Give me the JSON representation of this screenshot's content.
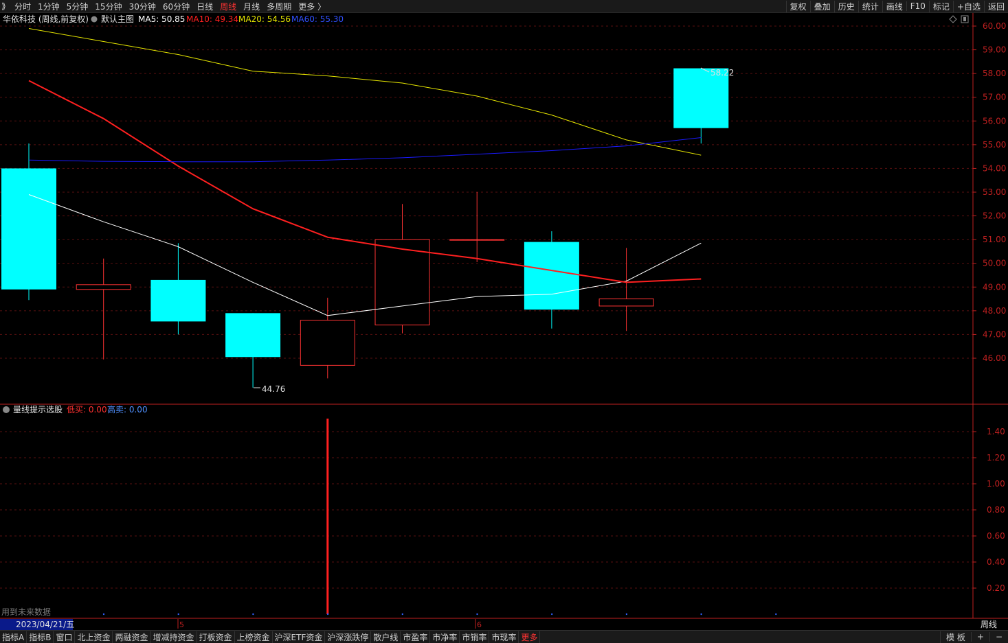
{
  "topbar": {
    "collapse_glyph": "⟫",
    "periods": [
      "分时",
      "1分钟",
      "5分钟",
      "15分钟",
      "30分钟",
      "60分钟",
      "日线",
      "周线",
      "月线",
      "多周期",
      "更多 〉"
    ],
    "active_period": "周线",
    "actions": [
      "复权",
      "叠加",
      "历史",
      "统计",
      "画线",
      "F10",
      "标记",
      "+自选",
      "返回"
    ]
  },
  "main_panel": {
    "stock_title": "华依科技 (周线,前复权)",
    "template_label": "默认主图",
    "ma5": "MA5: 50.85",
    "ma10": "MA10: 49.34",
    "ma20": "MA20: 54.56",
    "ma60": "MA60: 55.30",
    "high_annotation": "58.22",
    "low_annotation": "44.76"
  },
  "sub_panel": {
    "indicator_name": "量线提示选股",
    "low_buy": "低买: 0.00",
    "high_sell": "高卖: 0.00",
    "future_data_note": "用到未来数据"
  },
  "date_axis": {
    "cursor_date": "2023/04/21/五",
    "month_marks": [
      "5",
      "6"
    ],
    "period_label": "周线"
  },
  "colors": {
    "up": "#ff3333",
    "down": "#00ffff",
    "ma5": "#ffffff",
    "ma10": "#ff2020",
    "ma20": "#e6e600",
    "ma60": "#1a1aff",
    "axis": "#c02020",
    "grid": "#5a1010",
    "signal": "#ff2020"
  },
  "chart_data": [
    {
      "type": "candlestick",
      "title": "华依科技 (周线,前复权)",
      "ylim": [
        45.0,
        60.4
      ],
      "y_ticks": [
        46.0,
        47.0,
        48.0,
        49.0,
        50.0,
        51.0,
        52.0,
        53.0,
        54.0,
        55.0,
        56.0,
        57.0,
        58.0,
        59.0,
        60.0
      ],
      "candles": [
        {
          "open": 54.0,
          "close": 48.9,
          "high": 55.05,
          "low": 48.45
        },
        {
          "open": 48.9,
          "close": 49.1,
          "high": 50.2,
          "low": 45.95
        },
        {
          "open": 49.3,
          "close": 47.55,
          "high": 50.85,
          "low": 47.0
        },
        {
          "open": 47.9,
          "close": 46.05,
          "high": 47.9,
          "low": 44.76
        },
        {
          "open": 45.7,
          "close": 47.6,
          "high": 48.55,
          "low": 45.15
        },
        {
          "open": 47.4,
          "close": 51.0,
          "high": 52.5,
          "low": 47.05
        },
        {
          "open": 51.0,
          "close": 51.0,
          "high": 53.0,
          "low": 50.05
        },
        {
          "open": 50.9,
          "close": 48.05,
          "high": 51.35,
          "low": 47.25
        },
        {
          "open": 48.2,
          "close": 48.5,
          "high": 50.65,
          "low": 47.15
        },
        {
          "open": 58.22,
          "close": 55.7,
          "high": 58.22,
          "low": 55.05
        }
      ],
      "series": [
        {
          "name": "MA5",
          "values": [
            52.9,
            51.75,
            50.7,
            49.2,
            47.8,
            48.2,
            48.6,
            48.7,
            49.25,
            50.85
          ]
        },
        {
          "name": "MA10",
          "values": [
            57.7,
            56.1,
            54.1,
            52.3,
            51.1,
            50.6,
            50.2,
            49.7,
            49.2,
            49.34
          ]
        },
        {
          "name": "MA20",
          "values": [
            59.9,
            59.35,
            58.8,
            58.1,
            57.9,
            57.6,
            57.05,
            56.25,
            55.2,
            54.56
          ]
        },
        {
          "name": "MA60",
          "values": [
            54.35,
            54.3,
            54.28,
            54.28,
            54.35,
            54.45,
            54.6,
            54.75,
            54.95,
            55.3
          ]
        }
      ]
    },
    {
      "type": "bar",
      "title": "量线提示选股",
      "ylim": [
        0.0,
        1.6
      ],
      "y_ticks": [
        0.2,
        0.4,
        0.6,
        0.8,
        1.0,
        1.2,
        1.4
      ],
      "series": [
        {
          "name": "低买",
          "values": [
            0,
            0,
            0,
            0,
            1.5,
            0,
            0,
            0,
            0,
            0
          ]
        },
        {
          "name": "高卖",
          "values": [
            0,
            0,
            0,
            0,
            0,
            0,
            0,
            0,
            0,
            0
          ]
        }
      ]
    }
  ]
}
